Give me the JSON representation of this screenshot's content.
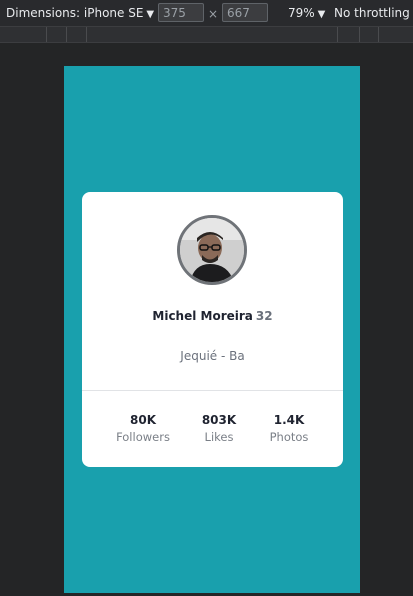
{
  "devtools": {
    "dimensions_label": "Dimensions: iPhone SE",
    "width_value": "375",
    "height_value": "667",
    "times_symbol": "×",
    "zoom": "79%",
    "throttling": "No throttling",
    "caret": "▼"
  },
  "profile": {
    "name": "Michel Moreira",
    "age": "32",
    "location": "Jequié - Ba",
    "stats": [
      {
        "value": "80K",
        "label": "Followers"
      },
      {
        "value": "803K",
        "label": "Likes"
      },
      {
        "value": "1.4K",
        "label": "Photos"
      }
    ]
  },
  "colors": {
    "background": "#19a0ad",
    "card": "#ffffff",
    "text": "#1f2330",
    "muted": "#6b717c"
  }
}
